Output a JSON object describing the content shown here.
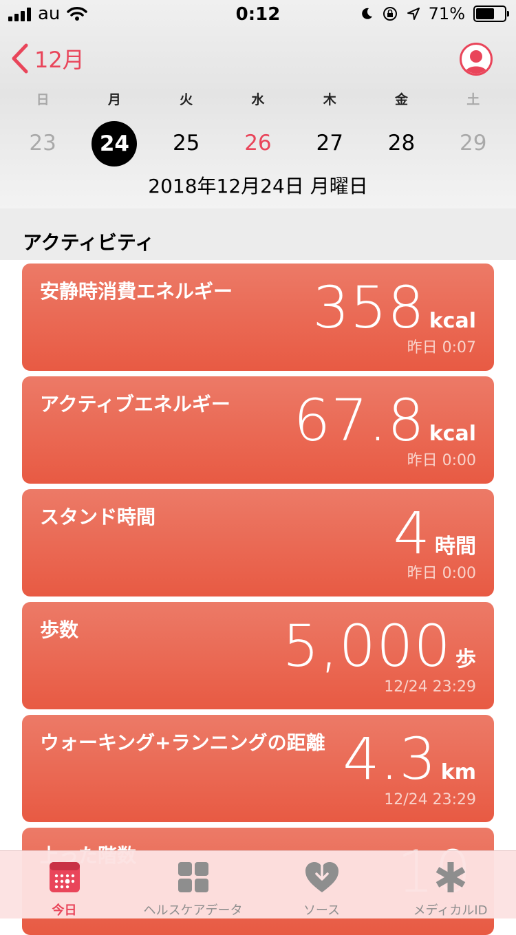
{
  "status_bar": {
    "carrier": "au",
    "time": "0:12",
    "battery": "71%",
    "battery_level": 0.71
  },
  "header": {
    "back_label": "12月"
  },
  "week": {
    "weekday_labels": [
      "日",
      "月",
      "火",
      "水",
      "木",
      "金",
      "土"
    ],
    "dates": [
      "23",
      "24",
      "25",
      "26",
      "27",
      "28",
      "29"
    ],
    "selected_index": 1,
    "highlight_index": 3
  },
  "date_label": "2018年12月24日 月曜日",
  "section_title": "アクティビティ",
  "cards": [
    {
      "title": "安静時消費エネルギー",
      "value": "358",
      "unit": "kcal",
      "time": "昨日 0:07"
    },
    {
      "title": "アクティブエネルギー",
      "value": "67.8",
      "unit": "kcal",
      "time": "昨日 0:00"
    },
    {
      "title": "スタンド時間",
      "value": "4",
      "unit": "時間",
      "time": "昨日 0:00"
    },
    {
      "title": "歩数",
      "value": "5,000",
      "unit": "歩",
      "time": "12/24 23:29"
    },
    {
      "title": "ウォーキング+ランニングの距離",
      "value": "4.3",
      "unit": "km",
      "time": "12/24 23:29"
    },
    {
      "title": "上った階数",
      "value": "10",
      "unit": "",
      "time": ""
    }
  ],
  "tabs": [
    {
      "label": "今日",
      "icon": "calendar-icon",
      "active": true
    },
    {
      "label": "ヘルスケアデータ",
      "icon": "grid-icon",
      "active": false
    },
    {
      "label": "ソース",
      "icon": "heart-download-icon",
      "active": false
    },
    {
      "label": "メディカルID",
      "icon": "medical-asterisk-icon",
      "active": false
    }
  ],
  "colors": {
    "accent": "#e9455a",
    "card_top": "#ec7a67",
    "card_bottom": "#e85a43"
  }
}
